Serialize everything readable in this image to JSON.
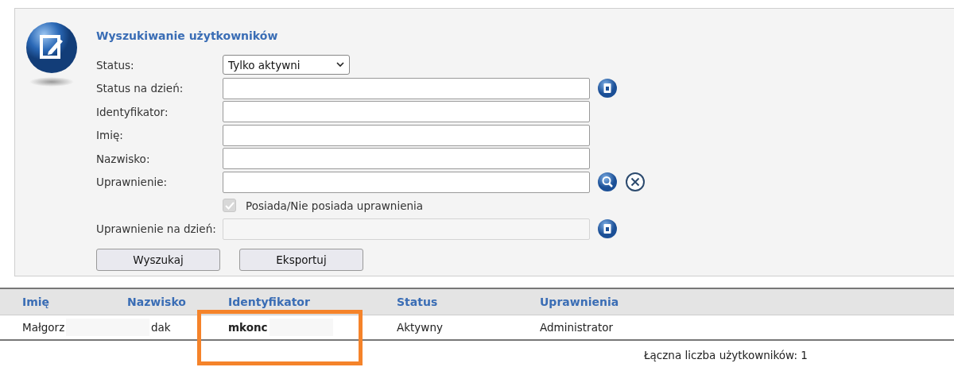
{
  "title": "Wyszukiwanie użytkowników",
  "fields": [
    {
      "kind": "select",
      "label": "Status:",
      "value": "Tylko aktywni"
    },
    {
      "kind": "date",
      "label": "Status na dzień:",
      "disabled": false
    },
    {
      "kind": "text",
      "label": "Identyfikator:"
    },
    {
      "kind": "text",
      "label": "Imię:"
    },
    {
      "kind": "text",
      "label": "Nazwisko:"
    },
    {
      "kind": "lookup",
      "label": "Uprawnienie:"
    },
    {
      "kind": "checkbox",
      "label": "Posiada/Nie posiada uprawnienia",
      "checked": true,
      "disabled": true
    },
    {
      "kind": "date",
      "label": "Uprawnienie na dzień:",
      "disabled": true
    }
  ],
  "buttons": [
    "Wyszukaj",
    "Eksportuj"
  ],
  "table": {
    "columns": [
      "Imię",
      "Nazwisko",
      "Identyfikator",
      "Status",
      "Uprawnienia"
    ],
    "rows": [
      {
        "cells": [
          "Małgorz",
          "dak",
          "mkonc",
          "Aktywny",
          "Administrator"
        ],
        "redacted": [
          true,
          true,
          true,
          false,
          false
        ]
      }
    ]
  },
  "total": "Łączna liczba użytkowników: 1",
  "highlight": true
}
